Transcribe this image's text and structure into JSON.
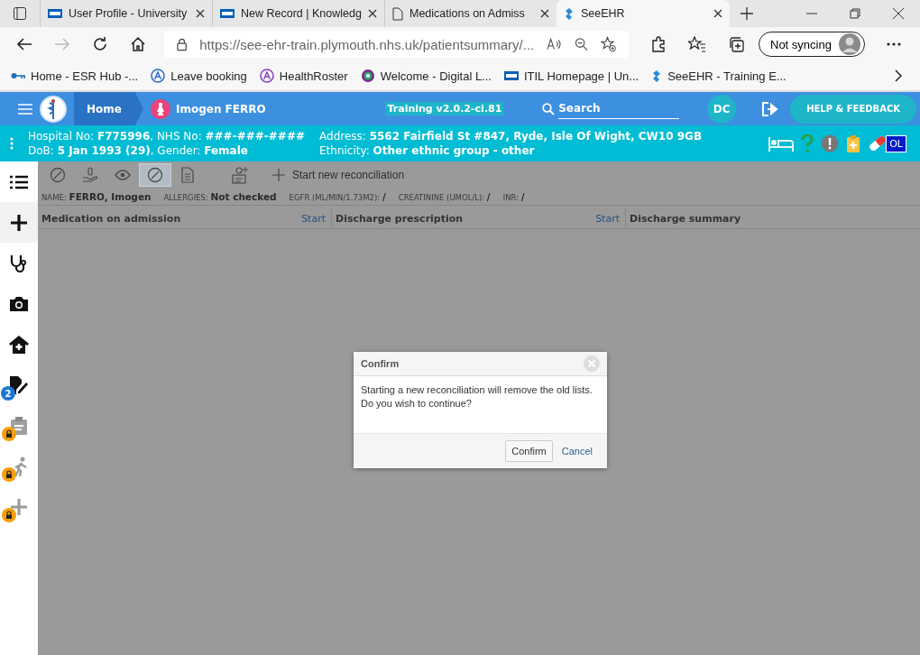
{
  "browser": {
    "tabs": [
      {
        "title": "User Profile - University",
        "selected": false
      },
      {
        "title": "New Record | Knowledg",
        "selected": false
      },
      {
        "title": "Medications on Admiss",
        "selected": false
      },
      {
        "title": "SeeEHR",
        "selected": true
      }
    ],
    "url_host": "https://see-ehr-train.plymouth.nhs.uk",
    "url_path": "/patientsummary/...",
    "sync": "Not syncing",
    "bookmarks": [
      {
        "label": "Home - ESR Hub -..."
      },
      {
        "label": "Leave booking"
      },
      {
        "label": "HealthRoster"
      },
      {
        "label": "Welcome - Digital L..."
      },
      {
        "label": "ITIL Homepage | Un..."
      },
      {
        "label": "SeeEHR - Training E..."
      }
    ]
  },
  "header": {
    "home": "Home",
    "patient": "Imogen FERRO",
    "version": "Training v2.0.2-ci.81",
    "search_placeholder": "Search",
    "avatar": "DC",
    "help": "HELP & FEEDBACK"
  },
  "banner": {
    "rows": [
      [
        {
          "label": "Hospital No: ",
          "value": "F775996"
        },
        {
          "label": ", NHS No: ",
          "value": "###-###-####"
        }
      ],
      [
        {
          "label": "DoB: ",
          "value": "5 Jan 1993 (29)"
        },
        {
          "label": ", Gender: ",
          "value": "Female"
        }
      ]
    ],
    "rows2": [
      [
        {
          "label": "Address: ",
          "value": "5562 Fairfield St #847, Ryde, Isle Of Wight, CW10 9GB"
        }
      ],
      [
        {
          "label": "Ethnicity: ",
          "value": "Other ethnic group - other"
        }
      ]
    ],
    "badge": "OL"
  },
  "sidebar": [
    {
      "kind": "list",
      "selected": false,
      "locked": false
    },
    {
      "kind": "plus",
      "selected": true,
      "locked": false
    },
    {
      "kind": "stethoscope",
      "selected": false,
      "locked": false
    },
    {
      "kind": "camera",
      "selected": false,
      "locked": false
    },
    {
      "kind": "house",
      "selected": false,
      "locked": false
    },
    {
      "kind": "edit",
      "selected": false,
      "locked": false,
      "badge": "2"
    },
    {
      "kind": "clipboard",
      "selected": false,
      "locked": true
    },
    {
      "kind": "walker",
      "selected": false,
      "locked": true
    },
    {
      "kind": "plus",
      "selected": false,
      "locked": true
    }
  ],
  "toolbar": {
    "buttons": [
      {
        "kind": "pill",
        "selected": false
      },
      {
        "kind": "hand",
        "selected": false
      },
      {
        "kind": "eye",
        "selected": false
      },
      {
        "kind": "pill",
        "selected": true
      },
      {
        "kind": "doc",
        "selected": false
      },
      {
        "kind": "ref",
        "selected": false
      }
    ],
    "action": "Start new reconciliation"
  },
  "info": [
    {
      "label": "NAME:",
      "value": "FERRO, Imogen"
    },
    {
      "label": "ALLERGIES:",
      "value": "Not checked"
    },
    {
      "label": "EGFR (ML/MIN/1.73M2):",
      "value": "/"
    },
    {
      "label": "CREATININE (UMOL/L):",
      "value": "/"
    },
    {
      "label": "INR:",
      "value": "/"
    }
  ],
  "columns": [
    {
      "title": "Medication on admission",
      "action": "Start"
    },
    {
      "title": "Discharge prescription",
      "action": "Start"
    },
    {
      "title": "Discharge summary"
    }
  ],
  "dialog": {
    "title": "Confirm",
    "message": [
      "Starting a new reconciliation will remove the old lists.",
      "Do you wish to continue?"
    ],
    "confirm": "Confirm",
    "cancel": "Cancel"
  }
}
